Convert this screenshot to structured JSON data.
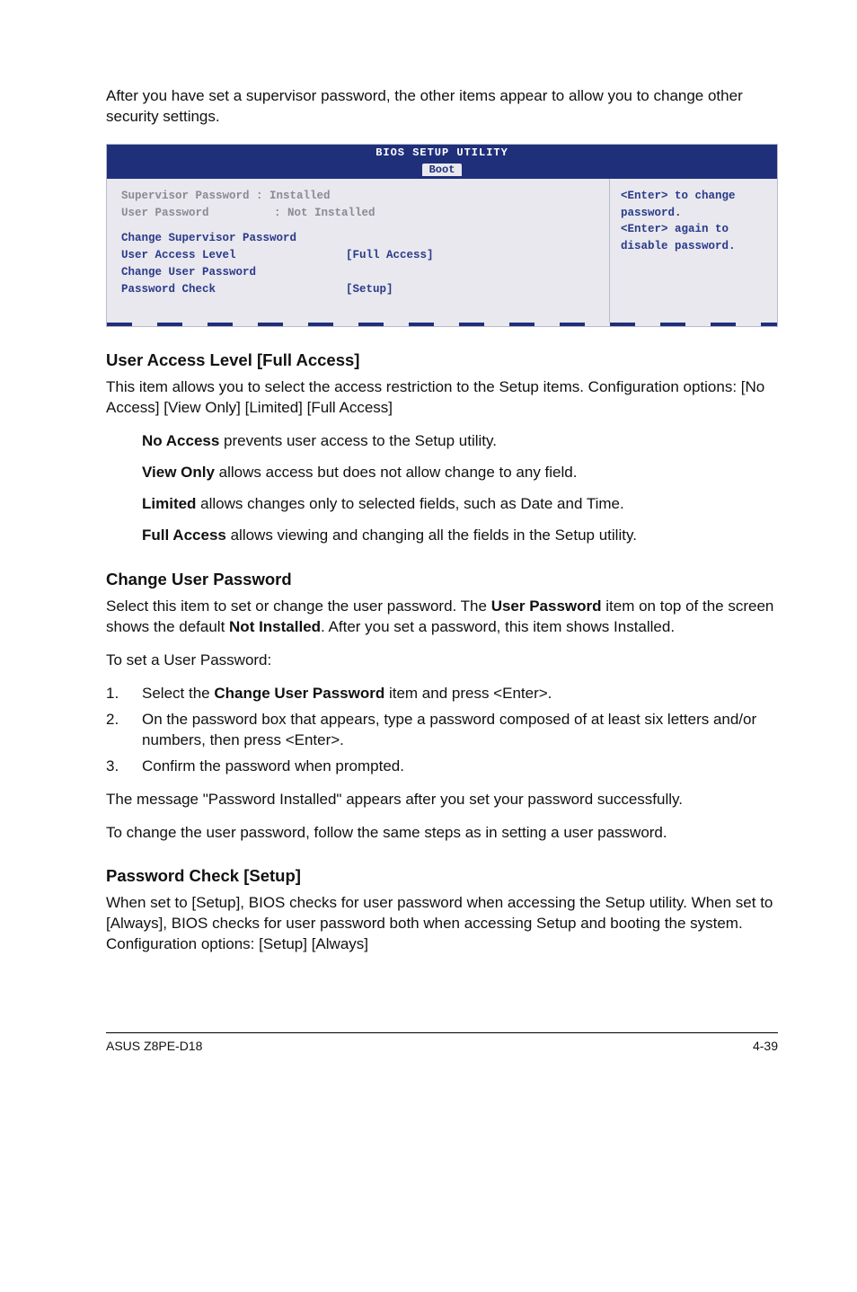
{
  "intro": "After you have set a supervisor password, the other items appear to allow you to change other security settings.",
  "bios": {
    "title": "BIOS SETUP UTILITY",
    "tab": "Boot",
    "left": {
      "supervisor_label": "Supervisor Password :",
      "supervisor_value": "Installed",
      "userpwd_label": "User Password",
      "userpwd_sep": ":",
      "userpwd_value": "Not Installed",
      "change_sup": "Change Supervisor Password",
      "ual_label": "User Access Level",
      "ual_value": "[Full Access]",
      "change_user": "Change User Password",
      "pwcheck_label": "Password Check",
      "pwcheck_value": "[Setup]"
    },
    "help": {
      "l1": "<Enter> to change",
      "l2": "password.",
      "l3": "<Enter> again to",
      "l4": "disable password."
    }
  },
  "ual": {
    "heading": "User Access Level [Full Access]",
    "p1": "This item allows you to select the access restriction to the Setup items. Configuration options: [No Access] [View Only] [Limited] [Full Access]",
    "no_access_b": "No Access",
    "no_access_t": " prevents user access to the Setup utility.",
    "view_only_b": "View Only",
    "view_only_t": " allows access but does not allow change to any field.",
    "limited_b": "Limited",
    "limited_t": " allows changes only to selected fields, such as Date and Time.",
    "full_b": "Full Access",
    "full_t": " allows viewing and changing all the fields in the Setup utility."
  },
  "cup": {
    "heading": "Change User Password",
    "p1a": "Select this item to set or change the user password. The ",
    "p1b_bold": "User Password",
    "p1c": " item on top of the screen shows the default ",
    "p1d_bold": "Not Installed",
    "p1e": ". After you set a password, this item shows Installed.",
    "p2": "To set a User Password:",
    "steps": {
      "s1a": "Select the ",
      "s1b_bold": "Change User Password",
      "s1c": " item and press <Enter>.",
      "s2": "On the password box that appears, type a password composed of at least six letters and/or numbers, then press <Enter>.",
      "s3": "Confirm the password when prompted."
    },
    "p3": "The message \"Password Installed\" appears after you set your password successfully.",
    "p4": "To change the user password, follow the same steps as in setting a user password."
  },
  "pc": {
    "heading": "Password Check [Setup]",
    "p1": "When set to [Setup], BIOS checks for user password when accessing the Setup utility. When set to [Always], BIOS checks for user password both when accessing Setup and booting the system. Configuration options: [Setup] [Always]"
  },
  "footer": {
    "left": "ASUS Z8PE-D18",
    "right": "4-39"
  }
}
